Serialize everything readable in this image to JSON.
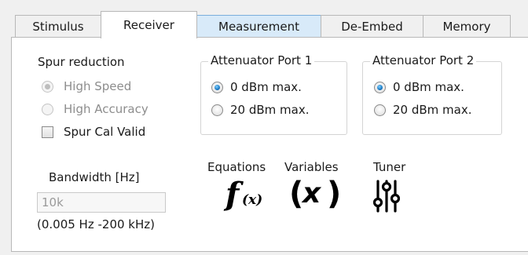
{
  "tabs": [
    {
      "label": "Stimulus"
    },
    {
      "label": "Receiver"
    },
    {
      "label": "Measurement"
    },
    {
      "label": "De-Embed"
    },
    {
      "label": "Memory"
    }
  ],
  "spur": {
    "title": "Spur reduction",
    "options": [
      "High Speed",
      "High Accuracy"
    ],
    "selected": "High Speed",
    "cal_label": "Spur Cal Valid"
  },
  "attenuator1": {
    "title": "Attenuator Port 1",
    "options": [
      "0 dBm max.",
      "20 dBm max."
    ],
    "selected": "0 dBm max."
  },
  "attenuator2": {
    "title": "Attenuator Port 2",
    "options": [
      "0 dBm max.",
      "20 dBm max."
    ],
    "selected": "0 dBm max."
  },
  "bandwidth": {
    "label": "Bandwidth [Hz]",
    "value": "10k",
    "range": "(0.005 Hz -200 kHz)"
  },
  "tools": {
    "equations_label": "Equations",
    "variables_label": "Variables",
    "tuner_label": "Tuner",
    "equations_icon": "function-fx-icon",
    "variables_icon": "variable-x-icon",
    "tuner_icon": "tuner-sliders-icon"
  }
}
